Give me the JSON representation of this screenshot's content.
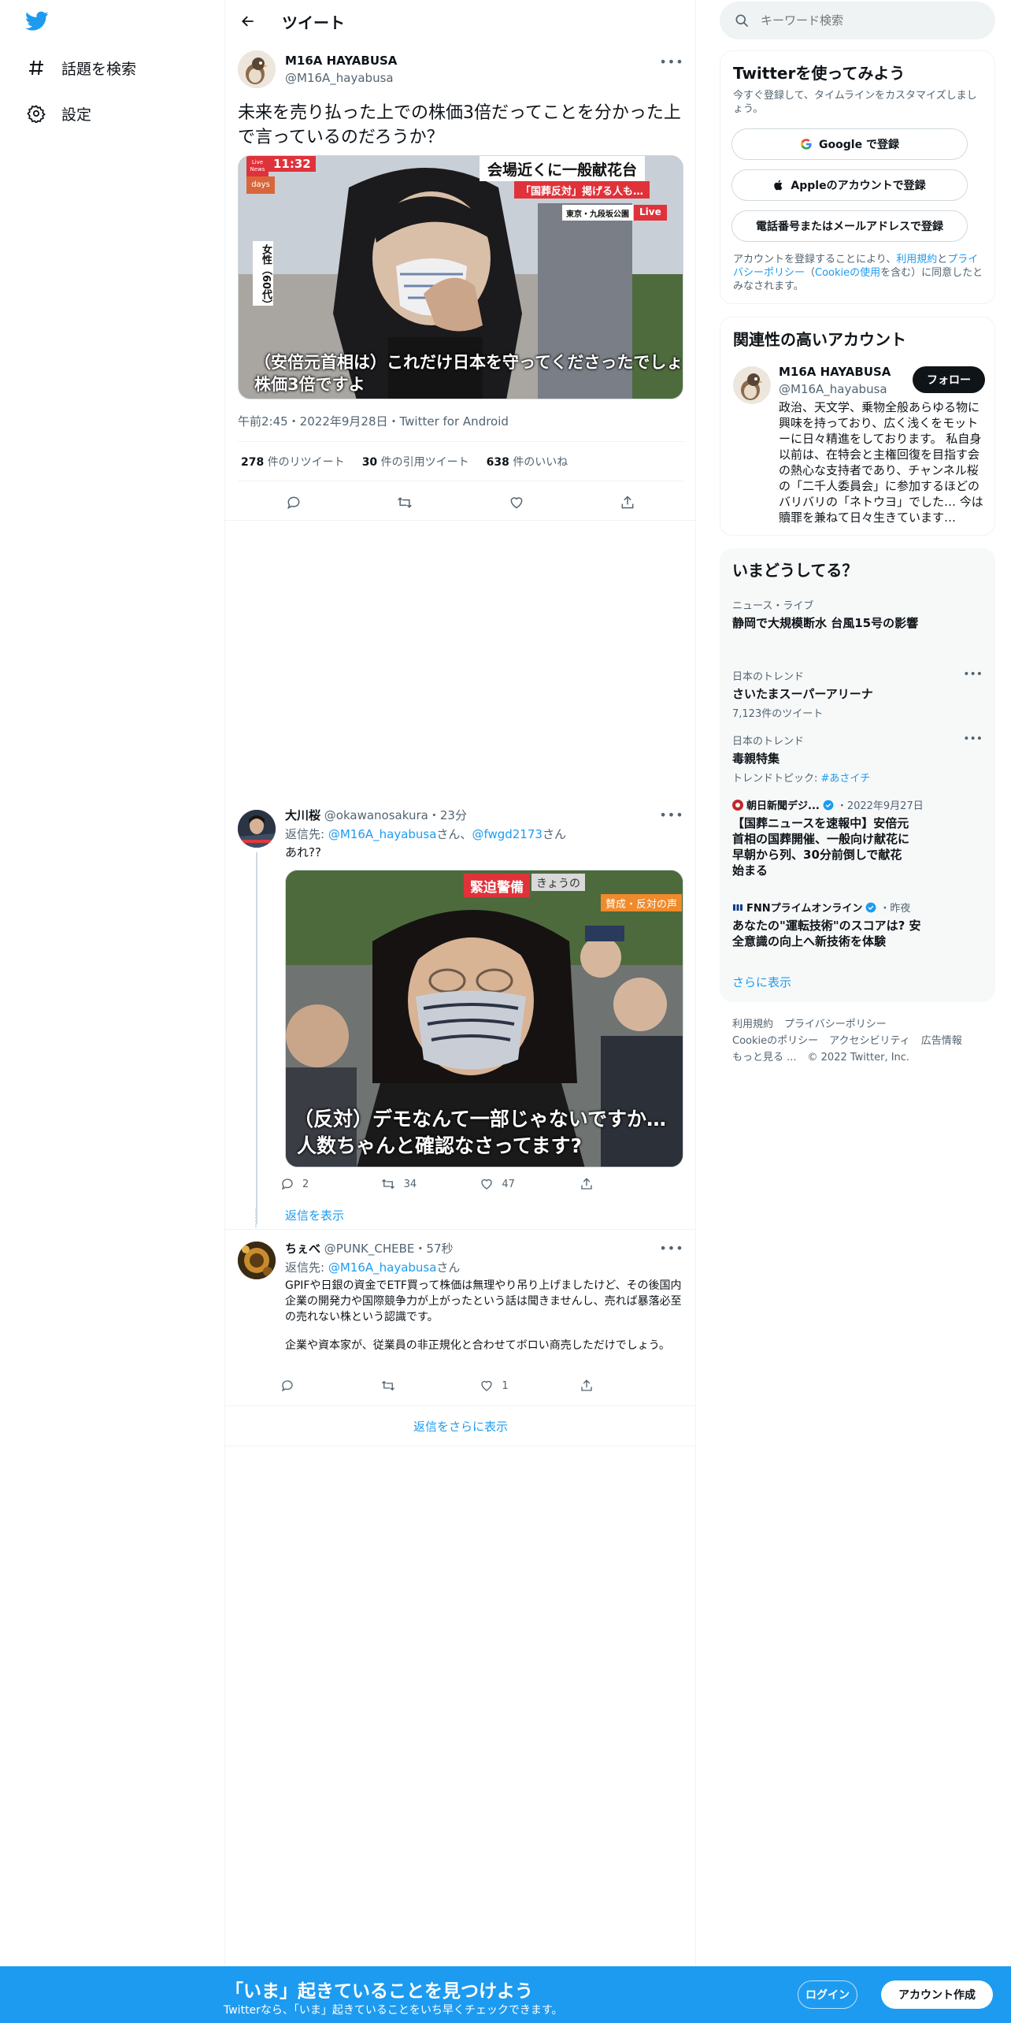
{
  "nav": {
    "items": [
      {
        "label": "話題を検索",
        "icon": "hashtag-icon"
      },
      {
        "label": "設定",
        "icon": "gear-icon"
      }
    ]
  },
  "header": {
    "title": "ツイート"
  },
  "main_tweet": {
    "author_name": "M16A HAYABUSA",
    "author_handle": "@M16A_hayabusa",
    "text": "未来を売り払った上での株価3倍だってことを分かった上で言っているのだろうか？",
    "image": {
      "live_badge_top": "Live News",
      "time": "11:32",
      "days": "days",
      "headline": "会場近くに一般献花台",
      "subheadline": "「国葬反対」掲げる人も…",
      "location": "東京・九段坂公園",
      "live": "Live",
      "side_caption": "女性（60代）",
      "caption_line1": "（安倍元首相は）これだけ日本を守ってくださったでしょ",
      "caption_line2": "株価3倍ですよ"
    },
    "timestamp": "午前2:45・2022年9月28日・Twitter for Android",
    "retweets": "278",
    "retweets_label": "件のリツイート",
    "quotes": "30",
    "quotes_label": "件の引用ツイート",
    "likes": "638",
    "likes_label": "件のいいね"
  },
  "replies": [
    {
      "name": "大川桜",
      "handle": "@okawanosakura",
      "time": "23分",
      "reply_to_prefix": "返信先: ",
      "reply_to_1": "@M16A_hayabusa",
      "reply_to_mid": "さん、",
      "reply_to_2": "@fwgd2173",
      "reply_to_suffix": "さん",
      "text": "あれ??",
      "image": {
        "banner": "緊迫警備",
        "banner_sub": "賛成・反対の声",
        "tag": "きょうの",
        "caption_line1": "（反対）デモなんて一部じゃないですか…",
        "caption_line2": "人数ちゃんと確認なさってます?"
      },
      "counts": {
        "reply": "2",
        "retweet": "34",
        "like": "47"
      },
      "show_replies": "返信を表示"
    },
    {
      "name": "ちぇべ",
      "handle": "@PUNK_CHEBE",
      "time": "57秒",
      "reply_to_prefix": "返信先: ",
      "reply_to_1": "@M16A_hayabusa",
      "reply_to_suffix": "さん",
      "text_p1": "GPIFや日銀の資金でETF買って株価は無理やり吊り上げましたけど、その後国内企業の開発力や国際競争力が上がったという話は聞きませんし、売れば暴落必至の売れない株という認識です。",
      "text_p2": "企業や資本家が、従業員の非正規化と合わせてボロい商売しただけでしょう。",
      "counts": {
        "reply": "",
        "retweet": "",
        "like": "1"
      }
    }
  ],
  "more_replies": "返信をさらに表示",
  "sidebar": {
    "search_placeholder": "キーワード検索",
    "signup": {
      "title": "Twitterを使ってみよう",
      "subtitle": "今すぐ登録して、タイムラインをカスタマイズしましょう。",
      "google": "Google で登録",
      "apple": "Appleのアカウントで登録",
      "phone": "電話番号またはメールアドレスで登録",
      "legal_1": "アカウントを登録することにより、",
      "legal_terms": "利用規約",
      "legal_2": "と",
      "legal_privacy": "プライバシーポリシー",
      "legal_3": "（",
      "legal_cookie": "Cookieの使用",
      "legal_4": "を含む）に同意したとみなされます。"
    },
    "related": {
      "title": "関連性の高いアカウント",
      "name": "M16A HAYABUSA",
      "handle": "@M16A_hayabusa",
      "follow": "フォロー",
      "bio": "政治、天文学、乗物全般あらゆる物に興味を持っており、広く浅くをモットーに日々精進をしております。 私自身以前は、在特会と主権回復を目指す会の熱心な支持者であり、チャンネル桜の「二千人委員会」に参加するほどの バリバリの「ネトウヨ」でした… 今は贖罪を兼ねて日々生きています…"
    },
    "trends": {
      "title": "いまどうしてる？",
      "items": [
        {
          "meta": "ニュース・ライブ",
          "title": "静岡で大規模断水 台風15号の影響"
        },
        {
          "meta": "日本のトレンド",
          "title": "さいたまスーパーアリーナ",
          "sub": "7,123件のツイート"
        },
        {
          "meta": "日本のトレンド",
          "title": "毒親特集",
          "sub_prefix": "トレンドトピック: ",
          "sub_link": "#あさイチ"
        },
        {
          "source": "朝日新聞デジ...",
          "date": "・2022年9月27日",
          "title": "【国葬ニュースを速報中】安倍元首相の国葬開催、一般向け献花に早朝から列、30分前倒しで献花始まる"
        },
        {
          "source": "FNNプライムオンライン",
          "date": "・昨夜",
          "title": "あなたの\"運転技術\"のスコアは? 安全意識の向上へ新技術を体験"
        }
      ],
      "show_more": "さらに表示"
    },
    "footer": {
      "terms": "利用規約",
      "privacy": "プライバシーポリシー",
      "cookie": "Cookieのポリシー",
      "accessibility": "アクセシビリティ",
      "ads": "広告情報",
      "more": "もっと見る ...",
      "copyright": "© 2022 Twitter, Inc."
    }
  },
  "bottom_bar": {
    "title": "「いま」起きていることを見つけよう",
    "subtitle": "Twitterなら、「いま」起きていることをいち早くチェックできます。",
    "login": "ログイン",
    "signup": "アカウント作成"
  },
  "colors": {
    "accent": "#1d9bf0",
    "text": "#0f1419",
    "muted": "#536471",
    "border": "#eff3f4",
    "verified": "#1d9bf0"
  }
}
